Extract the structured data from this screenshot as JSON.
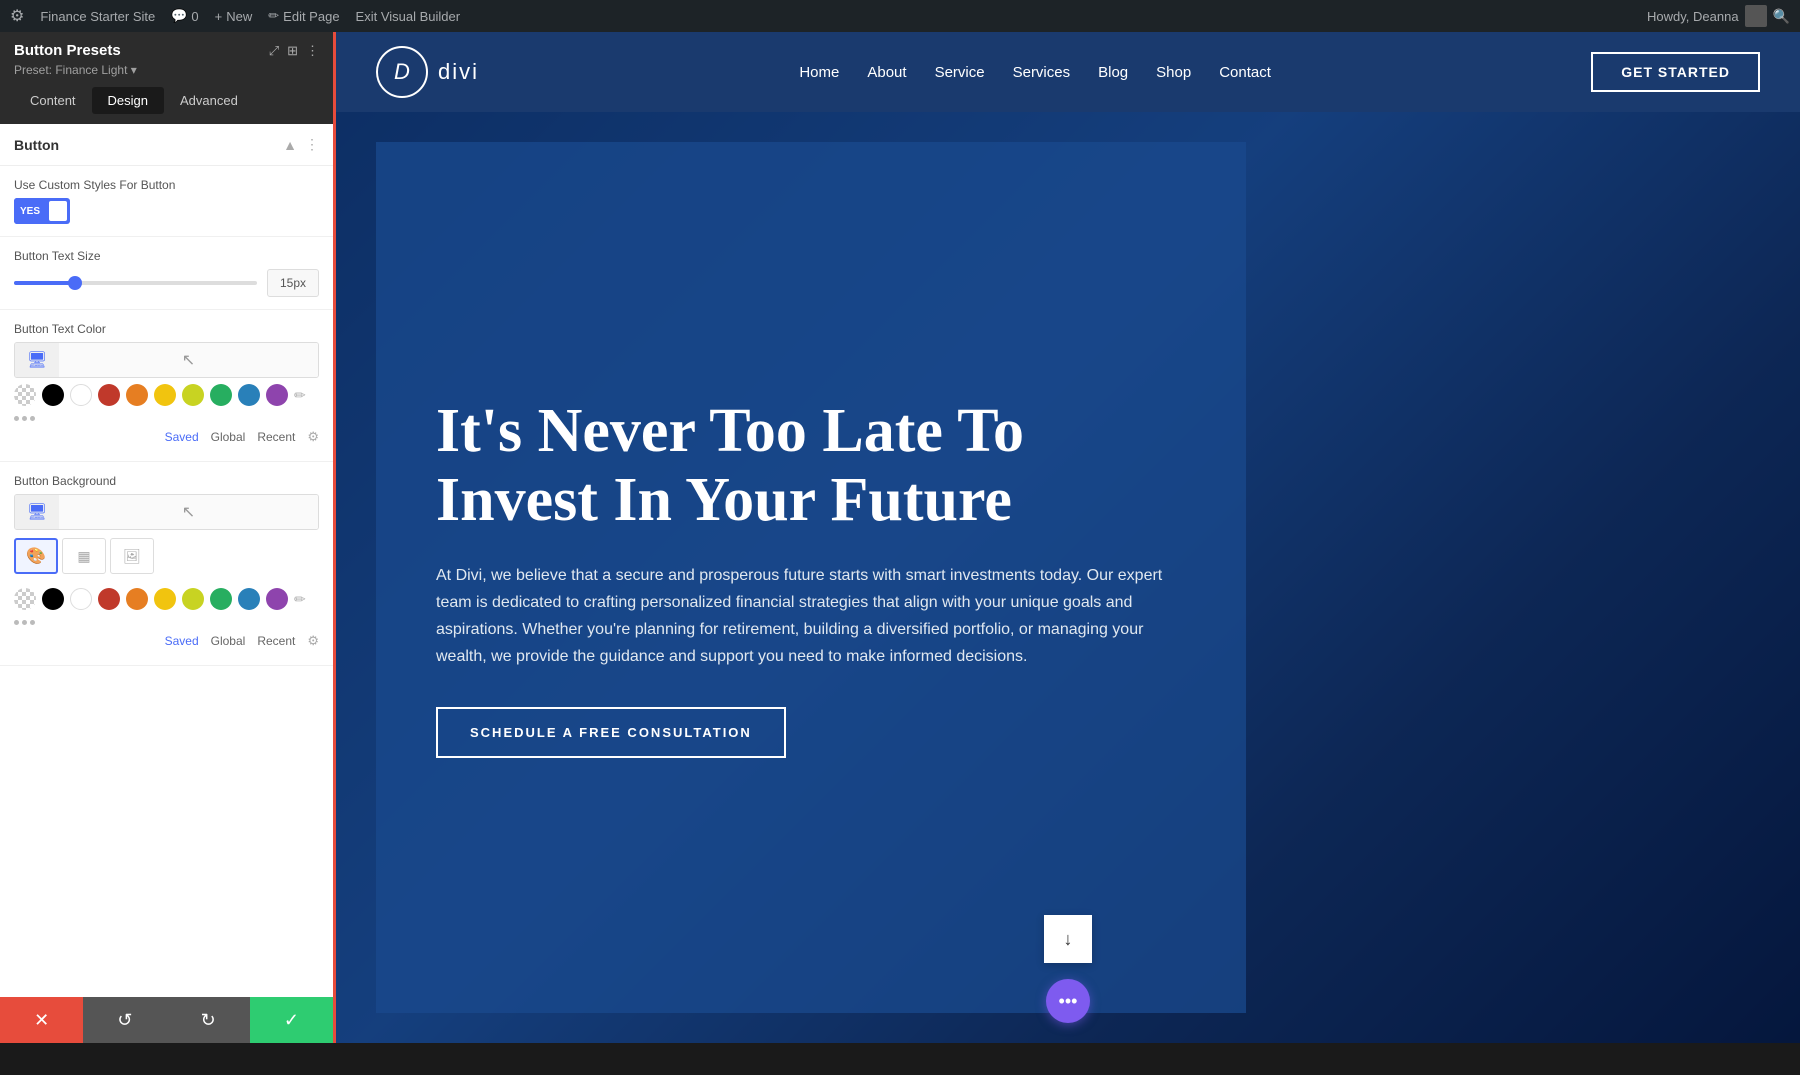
{
  "admin_bar": {
    "wp_icon": "W",
    "site_name": "Finance Starter Site",
    "comments": "0",
    "new_label": "New",
    "edit_page_label": "Edit Page",
    "exit_builder_label": "Exit Visual Builder",
    "howdy_label": "Howdy, Deanna"
  },
  "left_panel": {
    "title": "Button Presets",
    "preset_label": "Preset: Finance Light ▾",
    "tabs": {
      "content": "Content",
      "design": "Design",
      "advanced": "Advanced"
    },
    "section_title": "Button",
    "custom_styles_label": "Use Custom Styles For Button",
    "toggle_yes": "YES",
    "text_size_label": "Button Text Size",
    "text_size_value": "15px",
    "text_color_label": "Button Text Color",
    "bg_label": "Button Background",
    "palette": {
      "tabs": [
        "Saved",
        "Global",
        "Recent"
      ],
      "colors": [
        {
          "name": "checker",
          "value": "transparent"
        },
        {
          "name": "black",
          "value": "#000000"
        },
        {
          "name": "white",
          "value": "#ffffff"
        },
        {
          "name": "red",
          "value": "#c0392b"
        },
        {
          "name": "orange",
          "value": "#e67e22"
        },
        {
          "name": "yellow",
          "value": "#f1c40f"
        },
        {
          "name": "yellow-green",
          "value": "#c8d322"
        },
        {
          "name": "green",
          "value": "#27ae60"
        },
        {
          "name": "blue",
          "value": "#2980b9"
        },
        {
          "name": "purple",
          "value": "#8e44ad"
        }
      ]
    },
    "bottom_bar": {
      "close_icon": "✕",
      "undo_icon": "↺",
      "redo_icon": "↻",
      "save_icon": "✓"
    }
  },
  "site": {
    "logo_letter": "D",
    "logo_text": "divi",
    "nav_links": [
      "Home",
      "About",
      "Service",
      "Services",
      "Blog",
      "Shop",
      "Contact"
    ],
    "cta_btn": "GET STARTED",
    "hero": {
      "title": "It's Never Too Late To Invest In Your Future",
      "description": "At Divi, we believe that a secure and prosperous future starts with smart investments today. Our expert team is dedicated to crafting personalized financial strategies that align with your unique goals and aspirations. Whether you're planning for retirement, building a diversified portfolio, or managing your wealth, we provide the guidance and support you need to make informed decisions.",
      "cta_btn": "SCHEDULE A FREE CONSULTATION"
    }
  }
}
